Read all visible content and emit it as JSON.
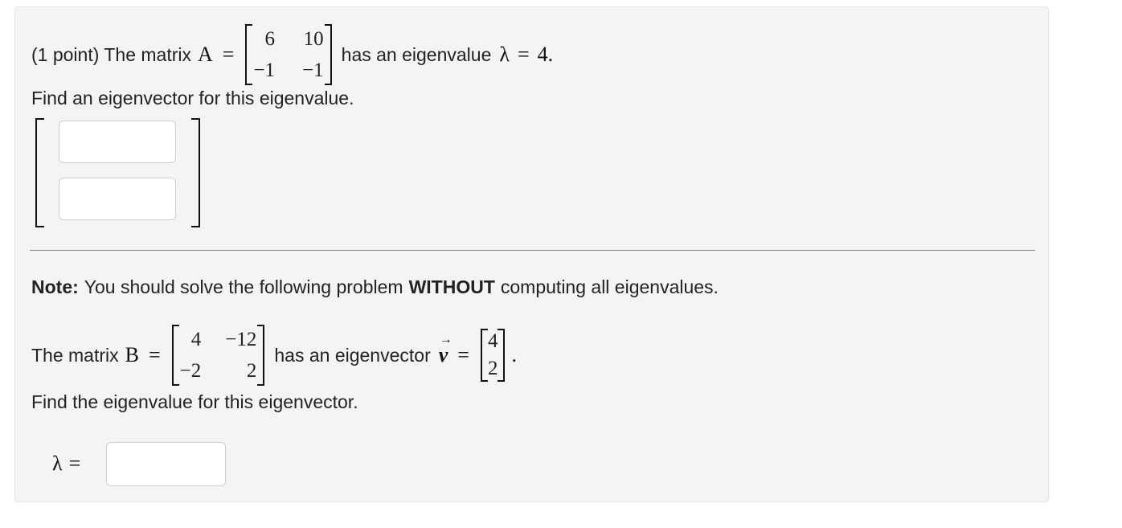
{
  "problem1": {
    "prefix": "(1 point) The matrix",
    "matrix_name": "A",
    "equals": "=",
    "matrix": [
      [
        "6",
        "10"
      ],
      [
        "−1",
        "−1"
      ]
    ],
    "mid_text": "has an eigenvalue",
    "lambda_symbol": "λ",
    "equals2": "=",
    "eigenvalue_value": "4.",
    "instruction": "Find an eigenvector for this eigenvalue."
  },
  "note": {
    "label": "Note:",
    "text_before": "You should solve the following problem",
    "emphasis": "WITHOUT",
    "text_after": "computing all eigenvalues."
  },
  "problem2": {
    "prefix": "The matrix",
    "matrix_name": "B",
    "equals": "=",
    "matrix": [
      [
        "4",
        "−12"
      ],
      [
        "−2",
        "2"
      ]
    ],
    "mid_text": "has an eigenvector",
    "vector_symbol": "v",
    "equals2": "=",
    "vector": [
      "4",
      "2"
    ],
    "period": ".",
    "instruction": "Find the eigenvalue for this eigenvector.",
    "answer_label": "λ",
    "answer_equals": "="
  }
}
